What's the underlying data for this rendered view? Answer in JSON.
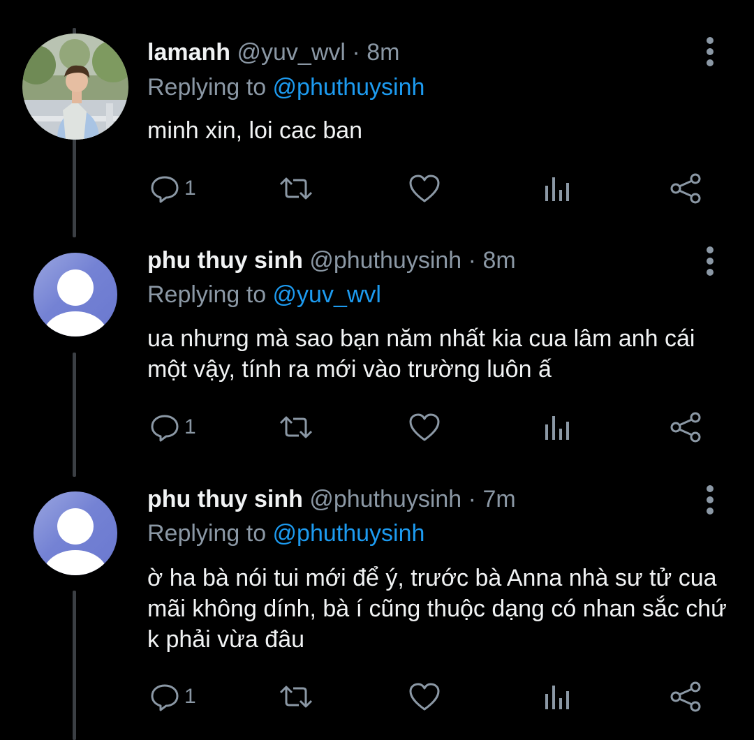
{
  "tweets": [
    {
      "name": "lamanh",
      "handle": "@yuv_wvl",
      "dot": "·",
      "time": "8m",
      "replying_prefix": "Replying to ",
      "replying_to": "@phuthuysinh",
      "text": "minh xin, loi cac ban",
      "reply_count": "1",
      "avatar": "photo-avatar"
    },
    {
      "name": "phu thuy sinh",
      "handle": "@phuthuysinh",
      "dot": "·",
      "time": "8m",
      "replying_prefix": "Replying to ",
      "replying_to": "@yuv_wvl",
      "text": "ua nhưng mà sao bạn năm nhất kia cua lâm anh cái một vậy, tính ra mới vào trường luôn ấ",
      "reply_count": "1",
      "avatar": "default-avatar"
    },
    {
      "name": "phu thuy sinh",
      "handle": "@phuthuysinh",
      "dot": "·",
      "time": "7m",
      "replying_prefix": "Replying to ",
      "replying_to": "@phuthuysinh",
      "text": "ờ ha bà nói tui mới để ý, trước bà Anna nhà sư tử cua mãi không dính, bà í cũng thuộc dạng có nhan sắc chứ k phải vừa đâu",
      "reply_count": "1",
      "avatar": "default-avatar"
    }
  ],
  "colors": {
    "background": "#000000",
    "secondary_text": "#8b98a5",
    "link": "#1d9bf0",
    "primary_text": "#f1f3f4",
    "thread_line": "#3b3f44"
  }
}
